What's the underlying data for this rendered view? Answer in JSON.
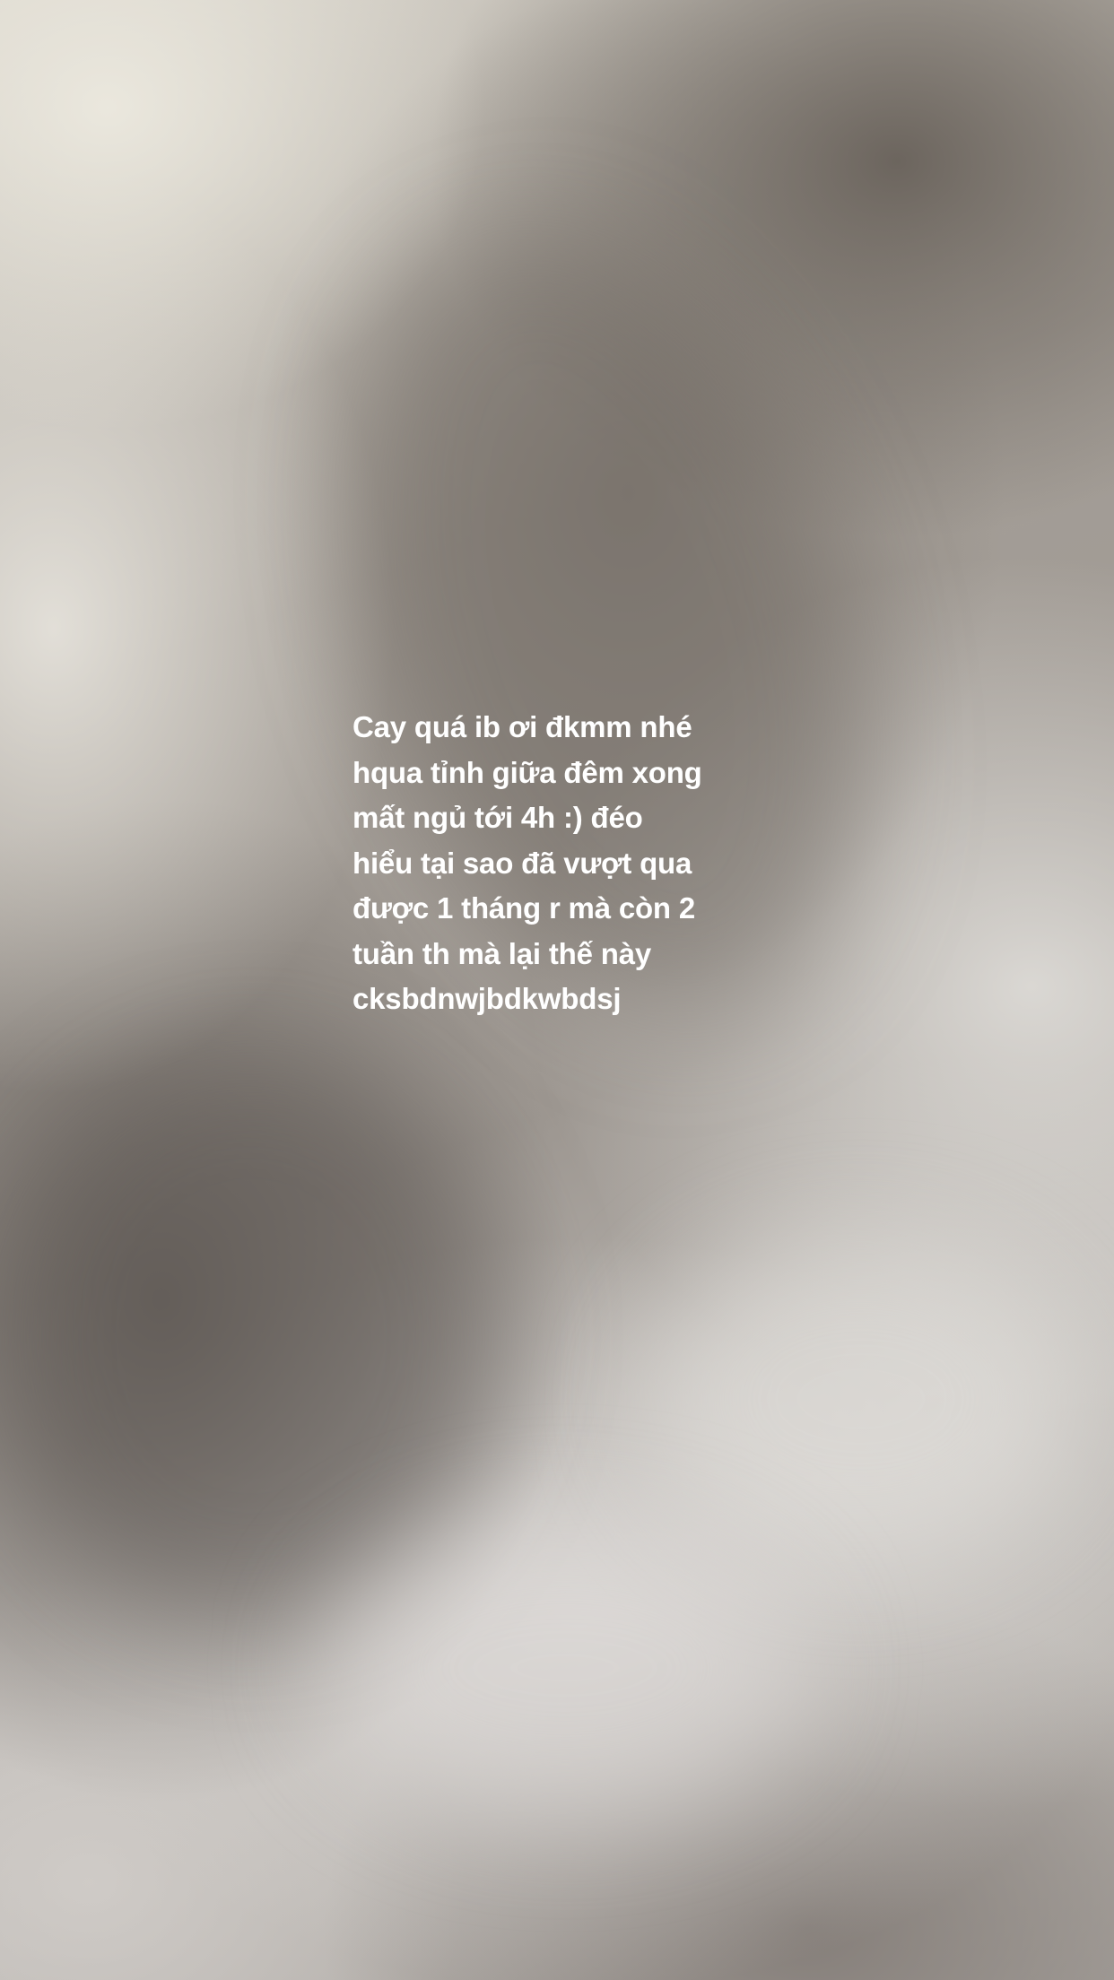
{
  "story": {
    "text_lines": [
      "Cay quá ib ơi đkmm nhé",
      "hqua tỉnh giữa đêm xong",
      "mất ngủ tới 4h :) đéo",
      "hiểu tại sao đã vượt qua",
      "được 1 tháng r mà còn 2",
      "tuần th mà lại thế này",
      "cksbdnwjbdkwbdsj"
    ],
    "text_color": "#ffffff"
  }
}
